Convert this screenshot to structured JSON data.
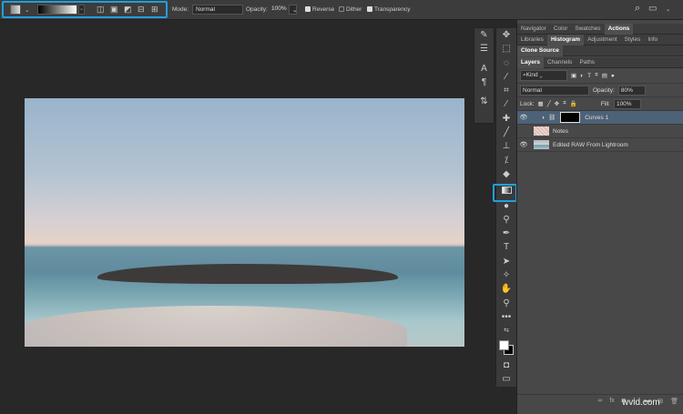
{
  "options_bar": {
    "mode_label": "Mode:",
    "mode_value": "Normal",
    "opacity_label": "Opacity:",
    "opacity_value": "100%",
    "reverse": {
      "label": "Reverse",
      "checked": true
    },
    "dither": {
      "label": "Dither",
      "checked": false
    },
    "transparency": {
      "label": "Transparency",
      "checked": true
    }
  },
  "toolbar": {
    "active_tool": "gradient-tool"
  },
  "panels": {
    "tabs_row1": [
      "Navigator",
      "Color",
      "Swatches",
      "Actions"
    ],
    "tabs_row2": [
      "Libraries",
      "Histogram",
      "Adjustment",
      "Styles",
      "Info"
    ],
    "tabs_row3": [
      "Clone Source"
    ],
    "tabs_row4": [
      "Layers",
      "Channels",
      "Paths"
    ],
    "filter_kind": "Kind",
    "blend_mode": "Normal",
    "opacity_label": "Opacity:",
    "opacity_value": "80%",
    "lock_label": "Lock:",
    "fill_label": "Fill:",
    "fill_value": "100%",
    "layers": [
      {
        "name": "Curves 1",
        "visible": true,
        "selected": true
      },
      {
        "name": "Notes",
        "visible": false
      },
      {
        "name": "Edited RAW From Lightroom",
        "visible": true
      }
    ]
  },
  "watermark": "wvid.com"
}
